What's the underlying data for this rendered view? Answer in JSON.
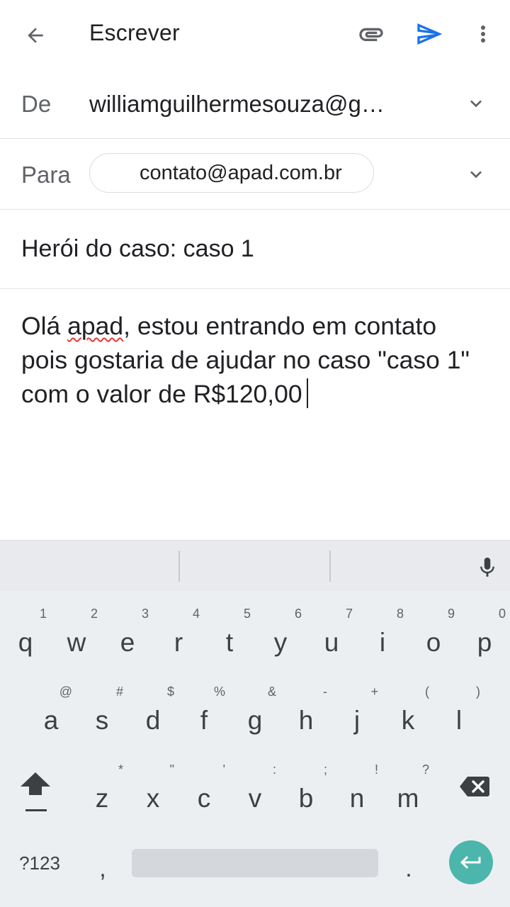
{
  "appbar": {
    "title": "Escrever",
    "back_icon": "arrow-back-icon",
    "attach_icon": "paperclip-icon",
    "send_icon": "send-icon",
    "more_icon": "more-vert-icon",
    "send_color": "#1a73e8"
  },
  "from": {
    "label": "De",
    "value": "williamguilhermesouza@g…"
  },
  "to": {
    "label": "Para",
    "chip": "contato@apad.com.br"
  },
  "subject": "Herói do caso: caso 1",
  "body": {
    "before_misspelled": "Olá ",
    "misspelled": "apad",
    "after_misspelled": ", estou entrando em contato pois gostaria de ajudar no caso \"caso 1\" com o valor de R$120,00"
  },
  "keyboard": {
    "row1": [
      {
        "key": "q",
        "hint": "1"
      },
      {
        "key": "w",
        "hint": "2"
      },
      {
        "key": "e",
        "hint": "3"
      },
      {
        "key": "r",
        "hint": "4"
      },
      {
        "key": "t",
        "hint": "5"
      },
      {
        "key": "y",
        "hint": "6"
      },
      {
        "key": "u",
        "hint": "7"
      },
      {
        "key": "i",
        "hint": "8"
      },
      {
        "key": "o",
        "hint": "9"
      },
      {
        "key": "p",
        "hint": "0"
      }
    ],
    "row2": [
      {
        "key": "a",
        "hint": "@"
      },
      {
        "key": "s",
        "hint": "#"
      },
      {
        "key": "d",
        "hint": "$"
      },
      {
        "key": "f",
        "hint": "%"
      },
      {
        "key": "g",
        "hint": "&"
      },
      {
        "key": "h",
        "hint": "-"
      },
      {
        "key": "j",
        "hint": "+"
      },
      {
        "key": "k",
        "hint": "("
      },
      {
        "key": "l",
        "hint": ")"
      }
    ],
    "row3": [
      {
        "key": "z",
        "hint": "*"
      },
      {
        "key": "x",
        "hint": "\""
      },
      {
        "key": "c",
        "hint": "'"
      },
      {
        "key": "v",
        "hint": ":"
      },
      {
        "key": "b",
        "hint": ";"
      },
      {
        "key": "n",
        "hint": "!"
      },
      {
        "key": "m",
        "hint": "?"
      }
    ],
    "symbols_label": "?123",
    "comma": ",",
    "period": ".",
    "enter_color": "#4db6ac"
  }
}
